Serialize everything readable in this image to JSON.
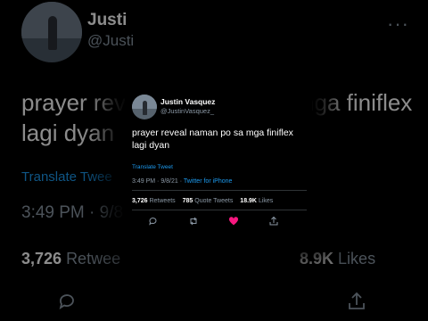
{
  "tweet": {
    "author_name": "Justin Vasquez",
    "author_handle": "@JustinVasquez_",
    "text": "prayer reveal naman po sa mga finiflex lagi dyan",
    "translate_label": "Translate Tweet",
    "time": "3:49 PM",
    "date": "9/8/21",
    "separator": "·",
    "source": "Twitter for iPhone",
    "retweets_count": "3,726",
    "retweets_label": "Retweets",
    "quotes_count": "785",
    "quotes_label": "Quote Tweets",
    "likes_count": "18.9K",
    "likes_label": "Likes",
    "liked": true
  },
  "background": {
    "name_fragment": "Justi",
    "handle_fragment": "@Justi",
    "more_glyph": "···",
    "text_line1": "prayer reveal",
    "text_line1_end": "nga finiflex",
    "text_line2": "lagi dyan",
    "translate_fragment": "Translate Twee",
    "time_fragment": "3:49 PM · 9/8",
    "retweets_fragment": "3,726",
    "retweets_label_fragment": "Retwee",
    "likes_fragment": "8.9K",
    "likes_label": "Likes"
  },
  "icons": {
    "reply": "reply-icon",
    "retweet": "retweet-icon",
    "like": "heart-icon",
    "share": "share-icon"
  },
  "colors": {
    "background": "#000000",
    "text": "#ffffff",
    "secondary": "#8b98a5",
    "link": "#1d9bf0",
    "like": "#f91880",
    "divider": "#2f3336"
  }
}
